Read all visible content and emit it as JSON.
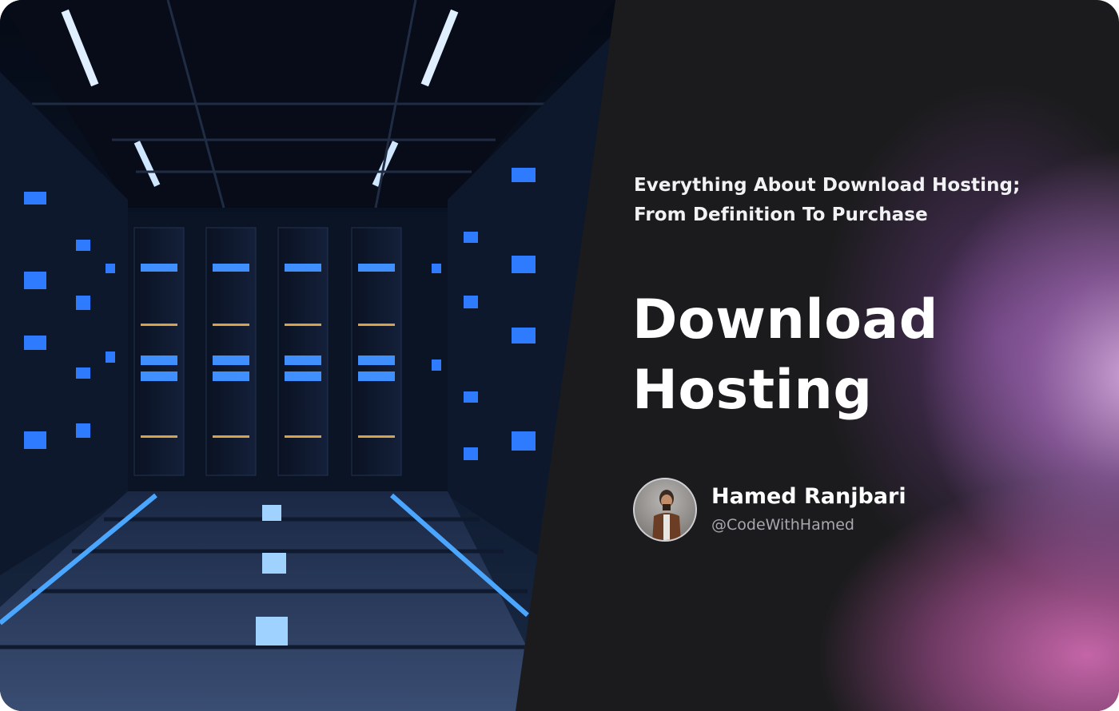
{
  "card": {
    "subtitle_line1": "Everything About Download Hosting;",
    "subtitle_line2": "From Definition To Purchase",
    "title_line1": "Download",
    "title_line2": "Hosting"
  },
  "author": {
    "name": "Hamed Ranjbari",
    "handle": "@CodeWithHamed"
  },
  "colors": {
    "background": "#1b1b1d",
    "accent_glow": "#c77fc0",
    "server_light": "#3a8cff"
  }
}
